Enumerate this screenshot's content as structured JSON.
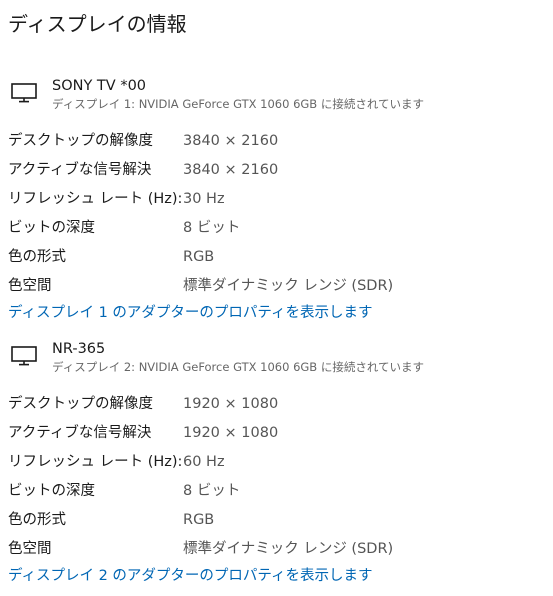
{
  "page": {
    "title": "ディスプレイの情報"
  },
  "icons": {
    "monitor": "monitor-icon"
  },
  "colors": {
    "link": "#0066b4",
    "text": "#1a1a1a",
    "secondary_text": "#666666"
  },
  "displays": [
    {
      "name": "SONY TV  *00",
      "subtitle": "ディスプレイ 1: NVIDIA GeForce GTX 1060 6GB に接続されています",
      "rows": [
        {
          "label": "デスクトップの解像度",
          "value": "3840 × 2160"
        },
        {
          "label": "アクティブな信号解決",
          "value": "3840 × 2160"
        },
        {
          "label": "リフレッシュ レート (Hz):",
          "value": "30 Hz"
        },
        {
          "label": "ビットの深度",
          "value": "8 ビット"
        },
        {
          "label": "色の形式",
          "value": "RGB"
        },
        {
          "label": "色空間",
          "value": "標準ダイナミック レンジ (SDR)"
        }
      ],
      "adapter_link": "ディスプレイ 1 のアダプターのプロパティを表示します"
    },
    {
      "name": "NR-365",
      "subtitle": "ディスプレイ 2: NVIDIA GeForce GTX 1060 6GB に接続されています",
      "rows": [
        {
          "label": "デスクトップの解像度",
          "value": "1920 × 1080"
        },
        {
          "label": "アクティブな信号解決",
          "value": "1920 × 1080"
        },
        {
          "label": "リフレッシュ レート (Hz):",
          "value": "60 Hz"
        },
        {
          "label": "ビットの深度",
          "value": "8 ビット"
        },
        {
          "label": "色の形式",
          "value": "RGB"
        },
        {
          "label": "色空間",
          "value": "標準ダイナミック レンジ (SDR)"
        }
      ],
      "adapter_link": "ディスプレイ 2 のアダプターのプロパティを表示します"
    }
  ]
}
